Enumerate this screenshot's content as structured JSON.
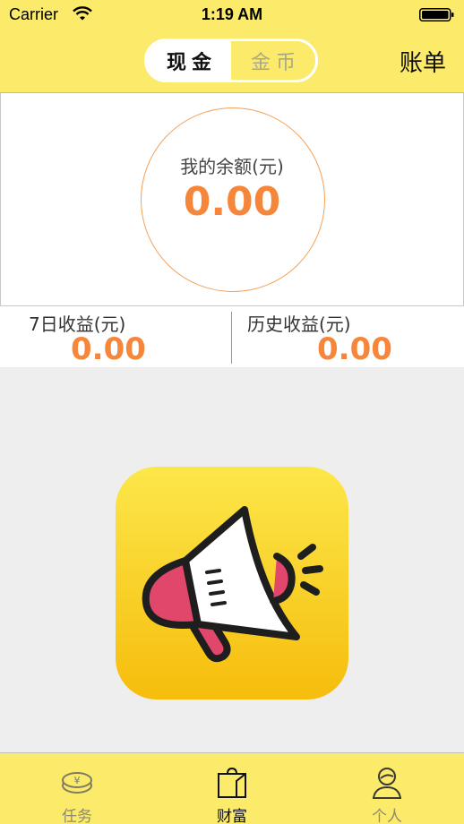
{
  "status_bar": {
    "carrier": "Carrier",
    "time": "1:19 AM",
    "icons": [
      "wifi-icon",
      "battery-icon"
    ]
  },
  "header": {
    "segments": [
      {
        "label": "现金",
        "selected": true
      },
      {
        "label": "金币",
        "selected": false
      }
    ],
    "bill_label": "账单"
  },
  "balance": {
    "label": "我的余额(元)",
    "value": "0.00"
  },
  "stats": {
    "seven_day": {
      "label": "7日收益(元)",
      "value": "0.00"
    },
    "history": {
      "label": "历史收益(元)",
      "value": "0.00"
    }
  },
  "promo_icon": "megaphone-icon",
  "tabbar": {
    "items": [
      {
        "label": "任务",
        "icon": "coin-icon",
        "active": false
      },
      {
        "label": "财富",
        "icon": "bag-icon",
        "active": true
      },
      {
        "label": "个人",
        "icon": "person-icon",
        "active": false
      }
    ]
  },
  "colors": {
    "header_bg": "#fcea6a",
    "accent_orange": "#f5863a",
    "page_bg": "#eeeeee",
    "megaphone_pink": "#e0476b"
  }
}
